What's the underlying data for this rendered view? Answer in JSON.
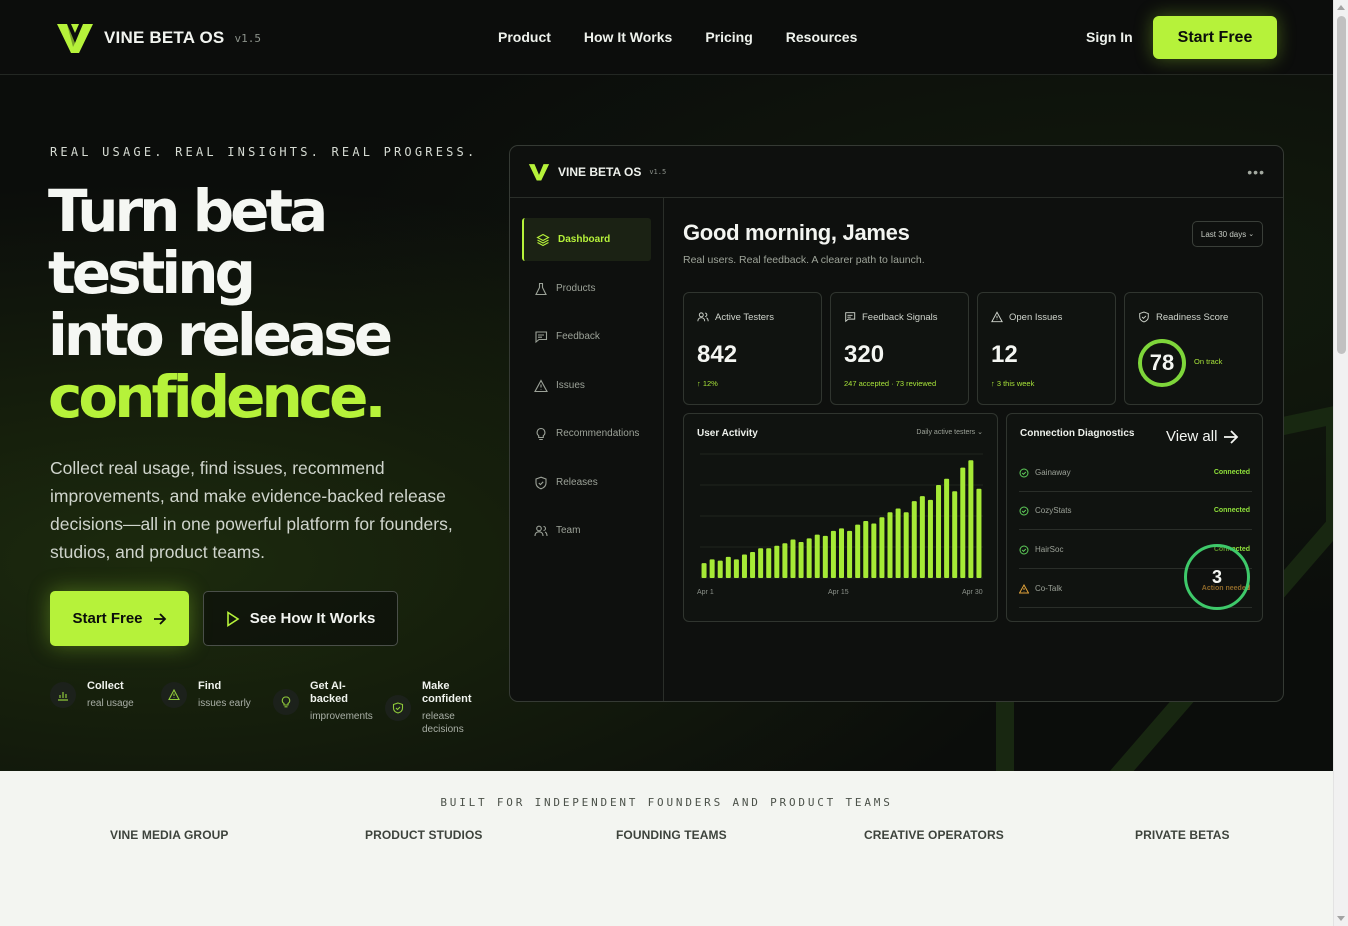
{
  "header": {
    "brand": "VINE BETA OS",
    "version": "v1.5",
    "nav": [
      "Product",
      "How It Works",
      "Pricing",
      "Resources"
    ],
    "signin": "Sign In",
    "cta": "Start Free"
  },
  "hero": {
    "eyebrow": "REAL USAGE. REAL INSIGHTS. REAL PROGRESS.",
    "headline_l1": "Turn beta",
    "headline_l2": "testing",
    "headline_l3": "into release",
    "headline_accent": "confidence.",
    "lede": "Collect real usage, find issues, recommend improvements, and make evidence-backed release decisions—all in one powerful platform for founders, studios, and product teams.",
    "cta_primary": "Start Free",
    "cta_secondary": "See How It Works",
    "features": [
      {
        "title": "Collect",
        "sub": "real usage",
        "icon": "bar-chart-icon"
      },
      {
        "title": "Find",
        "sub": "issues early",
        "icon": "warning-icon"
      },
      {
        "title": "Get AI-backed",
        "sub": "improvements",
        "icon": "lightbulb-icon"
      },
      {
        "title": "Make confident",
        "sub": "release decisions",
        "icon": "shield-check-icon"
      }
    ]
  },
  "dashboard": {
    "brand": "VINE BETA OS",
    "version": "v1.5",
    "menu": "•••",
    "sidebar": [
      "Dashboard",
      "Products",
      "Feedback",
      "Issues",
      "Recommendations",
      "Releases",
      "Team"
    ],
    "greeting": "Good morning, James",
    "greeting_sub": "Real users. Real feedback. A clearer path to launch.",
    "range": "Last 30 days",
    "stats": [
      {
        "label": "Active Testers",
        "value": "842",
        "sub": "↑ 12%"
      },
      {
        "label": "Feedback Signals",
        "value": "320",
        "sub": "247 accepted · 73 reviewed"
      },
      {
        "label": "Open Issues",
        "value": "12",
        "sub": "↑ 3 this week"
      },
      {
        "label": "Readiness Score",
        "value": "78",
        "sub": "On track"
      }
    ],
    "activity": {
      "title": "User Activity",
      "selector": "Daily active testers",
      "x_start": "Apr 1",
      "x_mid": "Apr 15",
      "x_end": "Apr 30"
    },
    "diagnostics": {
      "title": "Connection Diagnostics",
      "view_all": "View all",
      "rows": [
        {
          "name": "Gainaway",
          "status": "Connected"
        },
        {
          "name": "CozyStats",
          "status": "Connected"
        },
        {
          "name": "HairSoc",
          "status": "Connected"
        },
        {
          "name": "Co-Talk",
          "status": "Action needed"
        }
      ],
      "badge": "3"
    }
  },
  "chart_data": {
    "type": "bar",
    "title": "User Activity",
    "x_ticks": [
      "Apr 1",
      "Apr 15",
      "Apr 30"
    ],
    "values": [
      12,
      15,
      14,
      17,
      15,
      19,
      21,
      24,
      24,
      26,
      28,
      31,
      29,
      32,
      35,
      34,
      38,
      40,
      38,
      43,
      46,
      44,
      49,
      53,
      56,
      53,
      62,
      66,
      63,
      75,
      80,
      70,
      89,
      95,
      72
    ],
    "ylim": [
      0,
      100
    ],
    "bar_color": "#a6ea36"
  },
  "strip": {
    "eyebrow": "BUILT FOR INDEPENDENT FOUNDERS AND PRODUCT TEAMS",
    "logos": [
      "VINE MEDIA GROUP",
      "PRODUCT STUDIOS",
      "FOUNDING TEAMS",
      "CREATIVE OPERATORS",
      "PRIVATE BETAS"
    ]
  },
  "colors": {
    "accent": "#b6f23a",
    "background": "#0b0d0b",
    "strip": "#f3f5f1"
  }
}
